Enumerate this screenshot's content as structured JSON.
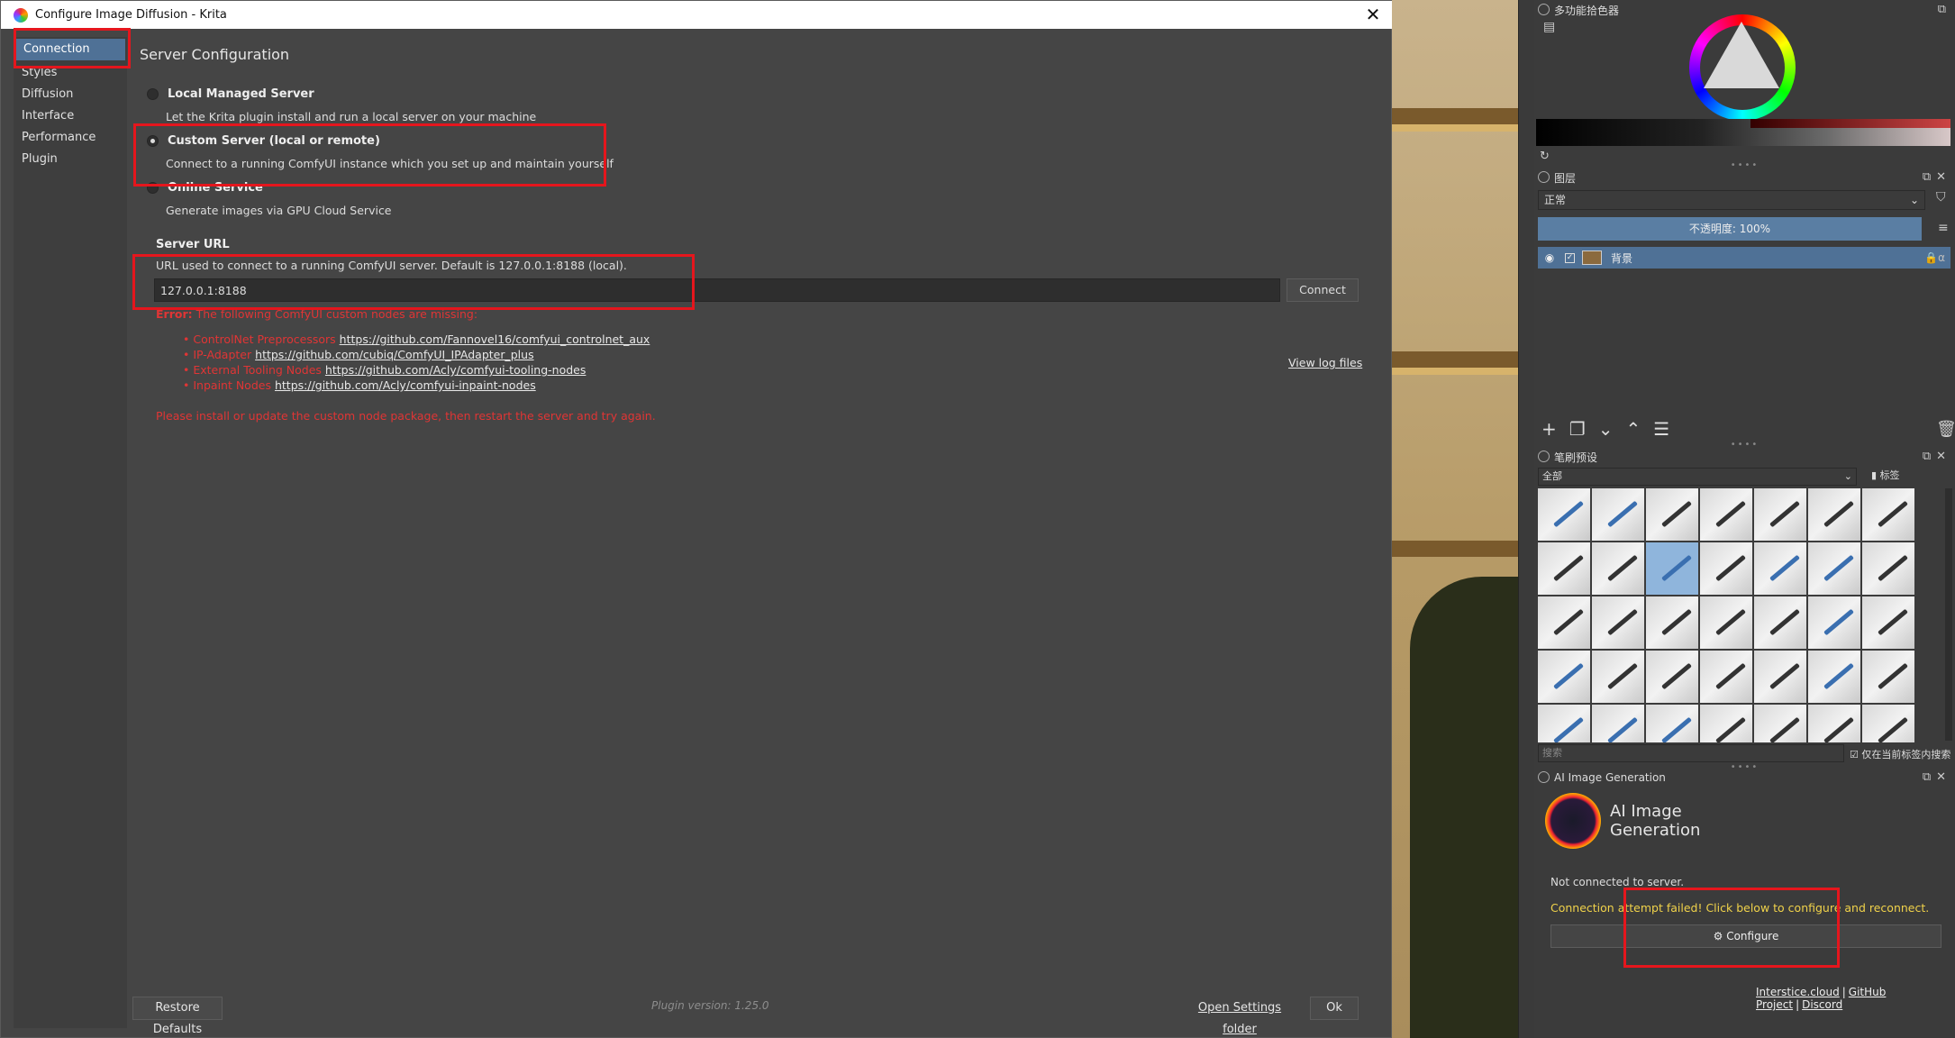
{
  "dialog": {
    "title": "Configure Image Diffusion - Krita",
    "nav": [
      "Connection",
      "Styles",
      "Diffusion",
      "Interface",
      "Performance",
      "Plugin"
    ],
    "page_title": "Server Configuration",
    "options": [
      {
        "label": "Local Managed Server",
        "desc": "Let the Krita plugin install and run a local server on your machine",
        "checked": false
      },
      {
        "label": "Custom Server (local or remote)",
        "desc": "Connect to a running ComfyUI instance which you set up and maintain yourself",
        "checked": true
      },
      {
        "label": "Online Service",
        "desc": "Generate images via GPU Cloud Service",
        "checked": false
      }
    ],
    "server_url": {
      "label": "Server URL",
      "desc": "URL used to connect to a running ComfyUI server. Default is 127.0.0.1:8188 (local).",
      "value": "127.0.0.1:8188",
      "connect_label": "Connect"
    },
    "error": {
      "prefix": "Error:",
      "message": "The following ComfyUI custom nodes are missing:",
      "missing": [
        {
          "name": "ControlNet Preprocessors",
          "url": "https://github.com/Fannovel16/comfyui_controlnet_aux"
        },
        {
          "name": "IP-Adapter",
          "url": "https://github.com/cubiq/ComfyUI_IPAdapter_plus"
        },
        {
          "name": "External Tooling Nodes",
          "url": "https://github.com/Acly/comfyui-tooling-nodes"
        },
        {
          "name": "Inpaint Nodes",
          "url": "https://github.com/Acly/comfyui-inpaint-nodes"
        }
      ],
      "install_msg": "Please install or update the custom node package, then restart the server and try again.",
      "view_log": "View log files"
    },
    "footer": {
      "restore": "Restore Defaults",
      "version": "Plugin version: 1.25.0",
      "open_settings": "Open Settings folder",
      "ok": "Ok"
    }
  },
  "dockers": {
    "color_title": "多功能拾色器",
    "layers_title": "图层",
    "blend_mode": "正常",
    "opacity": "不透明度: 100%",
    "layer_name": "背景",
    "brush_title": "笔刷预设",
    "brush_filter": "全部",
    "brush_tag": "标签",
    "brush_search_placeholder": "搜索",
    "brush_search_option": "仅在当前标签内搜索",
    "ai_title_bar": "AI Image Generation",
    "ai_title": "AI Image Generation",
    "status": "Not connected to server.",
    "failed": "Connection attempt failed! Click below to configure and reconnect.",
    "configure_label": "Configure",
    "links": [
      "Interstice.cloud",
      "GitHub Project",
      "Discord"
    ]
  },
  "colors": {
    "accent": "#4f7196",
    "error": "#e03535",
    "warning": "#f0d24a",
    "annotation": "#e5161d"
  }
}
